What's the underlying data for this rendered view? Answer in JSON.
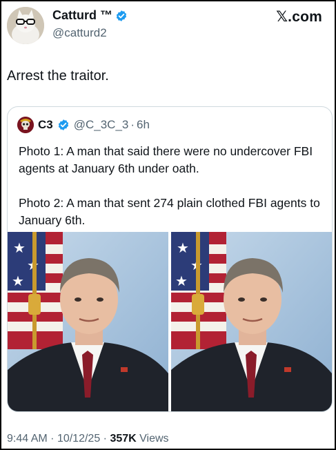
{
  "author": {
    "display_name": "Catturd ™",
    "handle": "@catturd2",
    "avatar_icon": "cat-avatar-icon",
    "verified_icon": "verified-badge-icon"
  },
  "brand": {
    "label": "𝕏.com"
  },
  "tweet": {
    "text": "Arrest the traitor."
  },
  "quote": {
    "name": "C3",
    "handle": "@C_3C_3",
    "separator": "·",
    "time": "6h",
    "paragraphs": [
      "Photo 1: A man that said there were no undercover FBI agents at January 6th under oath.",
      "Photo 2: A man that sent 274 plain clothed FBI agents to January 6th."
    ],
    "photos": [
      {
        "icon": "portrait-photo"
      },
      {
        "icon": "portrait-photo"
      }
    ]
  },
  "footer": {
    "time": "9:44 AM",
    "sep1": "·",
    "date": "10/12/25",
    "sep2": "·",
    "views_count": "357K",
    "views_label": "Views"
  },
  "colors": {
    "verified_blue": "#1d9bf0",
    "muted_text": "#536471",
    "border": "#cfd9de"
  }
}
